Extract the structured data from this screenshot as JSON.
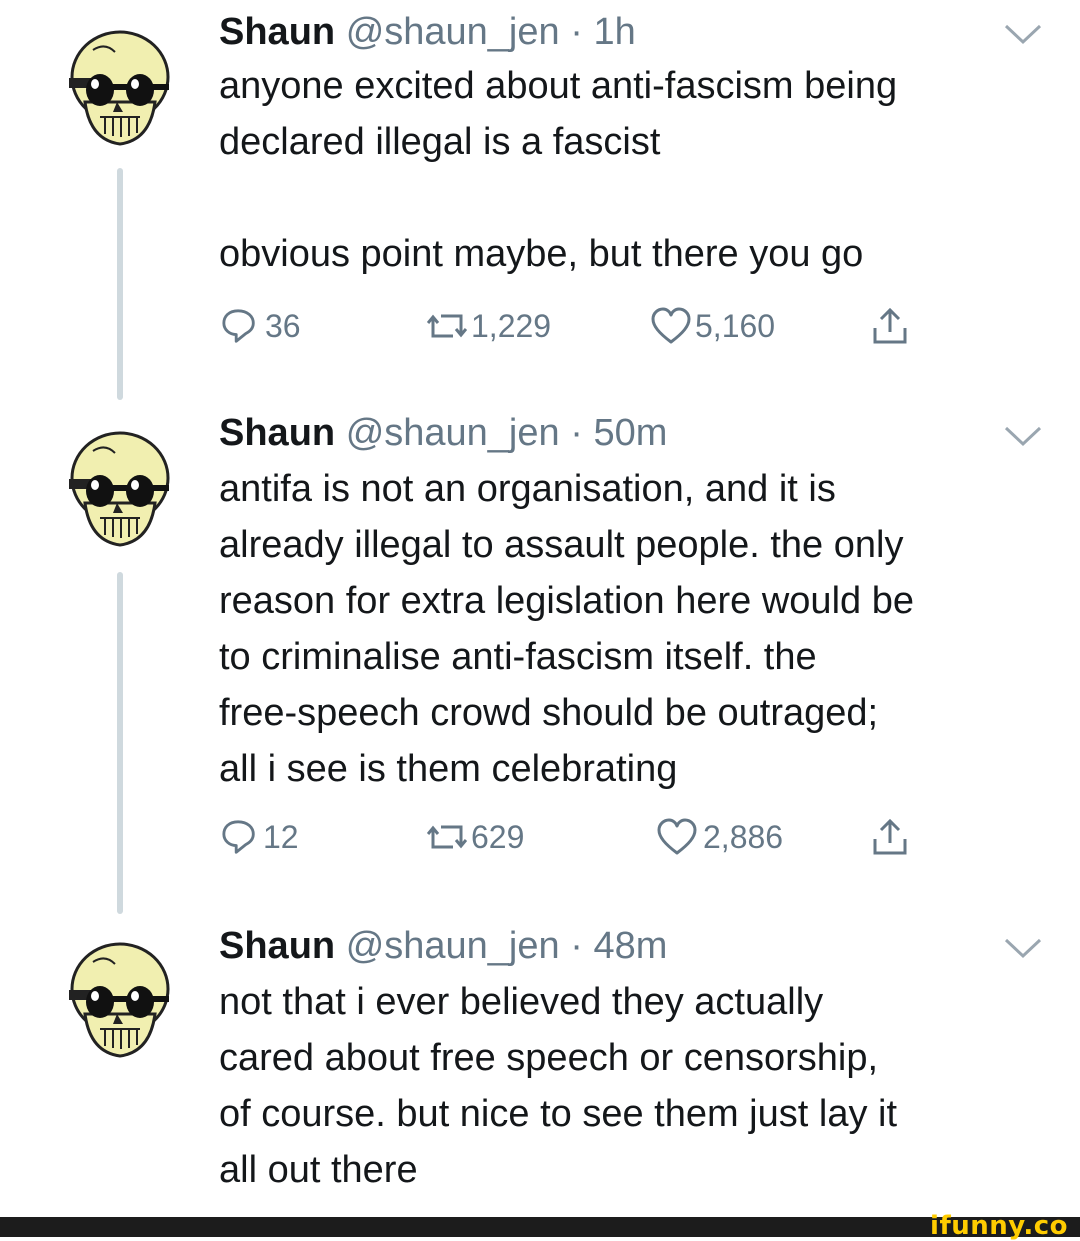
{
  "tweets": [
    {
      "name": "Shaun",
      "handle": "@shaun_jen",
      "dot": "·",
      "time": "1h",
      "text": "anyone excited about anti-fascism being\ndeclared illegal is a fascist\n\nobvious point maybe, but there you go",
      "replies": "36",
      "retweets": "1,229",
      "likes": "5,160"
    },
    {
      "name": "Shaun",
      "handle": "@shaun_jen",
      "dot": "·",
      "time": "50m",
      "text": "antifa is not an organisation, and it is\nalready illegal to assault people. the only\nreason for extra legislation here would be\nto criminalise anti-fascism itself. the\nfree-speech crowd should be outraged;\nall i see is them celebrating",
      "replies": "12",
      "retweets": "629",
      "likes": "2,886"
    },
    {
      "name": "Shaun",
      "handle": "@shaun_jen",
      "dot": "·",
      "time": "48m",
      "text": "not that i ever believed they actually\ncared about free speech or censorship,\nof course. but nice to see them just lay it\nall out there"
    }
  ],
  "icons": {
    "avatar": "skull-with-sunglasses-icon",
    "caret": "chevron-down-icon",
    "reply": "reply-icon",
    "retweet": "retweet-icon",
    "like": "heart-icon",
    "share": "share-icon"
  },
  "colors": {
    "muted": "#657786",
    "text": "#14171a",
    "line": "#cfd9de",
    "watermark": "#ffcc00"
  },
  "watermark": "ifunny.co"
}
